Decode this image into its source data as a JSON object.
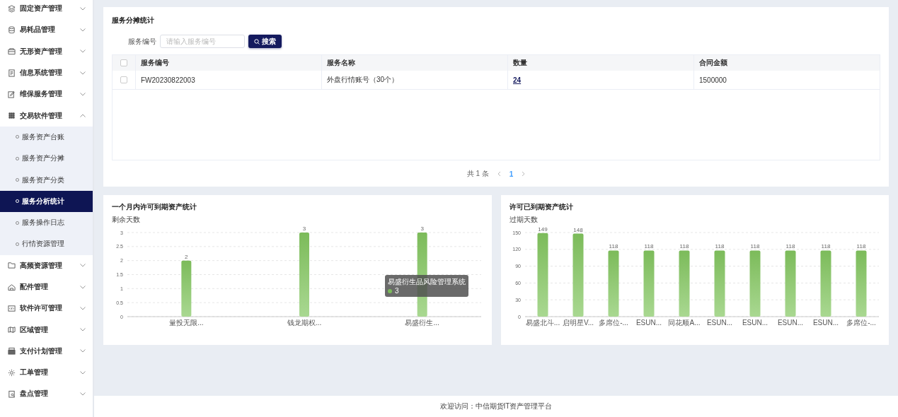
{
  "sidebar": {
    "items": [
      {
        "label": "固定资产管理",
        "expanded": false
      },
      {
        "label": "易耗品管理",
        "expanded": false
      },
      {
        "label": "无形资产管理",
        "expanded": false
      },
      {
        "label": "信息系统管理",
        "expanded": false
      },
      {
        "label": "维保服务管理",
        "expanded": false
      },
      {
        "label": "交易软件管理",
        "expanded": true,
        "children": [
          {
            "label": "服务资产台账",
            "selected": false
          },
          {
            "label": "服务资产分摊",
            "selected": false
          },
          {
            "label": "服务资产分类",
            "selected": false
          },
          {
            "label": "服务分析统计",
            "selected": true
          },
          {
            "label": "服务操作日志",
            "selected": false
          },
          {
            "label": "行情资源管理",
            "selected": false
          }
        ]
      },
      {
        "label": "高频资源管理",
        "expanded": false
      },
      {
        "label": "配件管理",
        "expanded": false
      },
      {
        "label": "软件许可管理",
        "expanded": false
      },
      {
        "label": "区域管理",
        "expanded": false
      },
      {
        "label": "支付计划管理",
        "expanded": false
      },
      {
        "label": "工单管理",
        "expanded": false
      },
      {
        "label": "盘点管理",
        "expanded": false
      }
    ]
  },
  "summary": {
    "title": "服务分摊统计",
    "search": {
      "label": "服务编号",
      "placeholder": "请输入服务编号",
      "button": "搜索"
    },
    "table": {
      "header_checked": false,
      "columns": [
        "服务编号",
        "服务名称",
        "数量",
        "合同金额"
      ],
      "rows": [
        {
          "checked": false,
          "cells": [
            "FW20230822003",
            "外盘行情账号（30个）",
            "24",
            "1500000"
          ]
        }
      ]
    },
    "pagination": {
      "total": "共 1 条",
      "pages": [
        {
          "label": "1",
          "selected": true
        }
      ]
    }
  },
  "charts": [
    {
      "title": "一个月内许可到期资产统计",
      "tooltip": {
        "title": "易盛衍生品风险管理系统",
        "value": "3"
      },
      "chart_data": {
        "type": "bar",
        "ylabel": "剩余天数",
        "categories": [
          "量投无限...",
          "钱龙期权...",
          "易盛衍生..."
        ],
        "series": [
          {
            "color": "#7cbb5a",
            "values": [
              2,
              3,
              3
            ]
          }
        ],
        "grid": true,
        "ylim": [
          0,
          3
        ],
        "yticks": [
          0,
          0.5,
          1,
          1.5,
          2,
          2.5,
          3
        ],
        "data_labels": true
      }
    },
    {
      "title": "许可已到期资产统计",
      "chart_data": {
        "type": "bar",
        "ylabel": "过期天数",
        "categories": [
          "易盛北斗...",
          "启明星V...",
          "多席位-...",
          "ESUN...",
          "同花顺A...",
          "ESUN...",
          "ESUN...",
          "ESUN...",
          "ESUN...",
          "多席位-..."
        ],
        "grid": true,
        "series": [
          {
            "color": "#7cbb5a",
            "values": [
              149,
              148,
              118,
              118,
              118,
              118,
              118,
              118,
              118,
              118
            ]
          }
        ],
        "ylim": [
          0,
          150
        ],
        "yticks": [
          0,
          30,
          60,
          90,
          120,
          150
        ],
        "data_labels": true
      }
    }
  ],
  "footer": "欢迎访问：中信期货IT资产管理平台"
}
